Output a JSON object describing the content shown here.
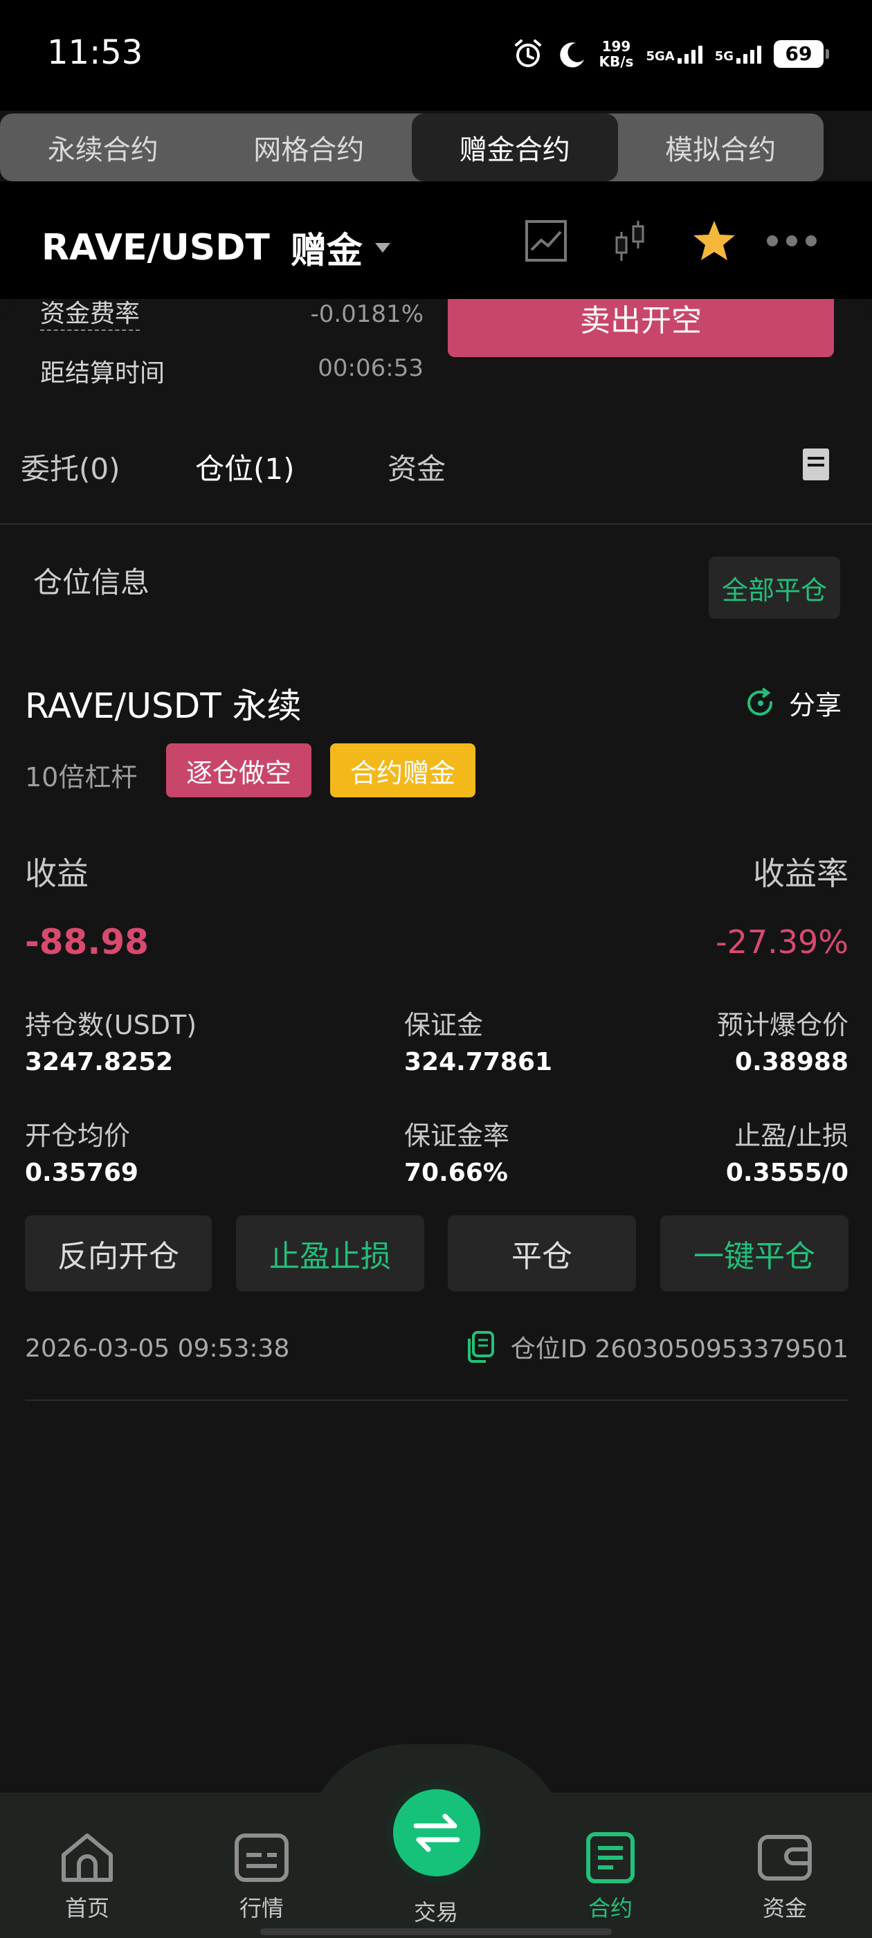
{
  "status_bar": {
    "time": "11:53",
    "speed_value": "199",
    "speed_unit": "KB/s",
    "net1": "5GA",
    "net2": "5G",
    "battery": "69"
  },
  "top_tabs": [
    "永续合约",
    "网格合约",
    "赠金合约",
    "模拟合约"
  ],
  "active_top_tab": 2,
  "header": {
    "pair": "RAVE/USDT",
    "mode": "赠金"
  },
  "funding": {
    "rate_label": "资金费率",
    "rate_value": "-0.0181%",
    "settle_label": "距结算时间",
    "settle_value": "00:06:53",
    "sell_button": "卖出开空"
  },
  "position_tabs": {
    "orders": "委托(0)",
    "positions": "仓位(1)",
    "assets": "资金"
  },
  "position_info": {
    "title": "仓位信息",
    "close_all": "全部平仓"
  },
  "position": {
    "symbol": "RAVE/USDT 永续",
    "share": "分享",
    "leverage": "10倍杠杆",
    "side_tag": "逐仓做空",
    "bonus_tag": "合约赠金",
    "pnl_label": "收益",
    "roi_label": "收益率",
    "pnl_value": "-88.98",
    "roi_value": "-27.39%",
    "size_label": "持仓数(USDT)",
    "size_value": "3247.8252",
    "margin_label": "保证金",
    "margin_value": "324.77861",
    "liq_label": "预计爆仓价",
    "liq_value": "0.38988",
    "entry_label": "开仓均价",
    "entry_value": "0.35769",
    "margin_ratio_label": "保证金率",
    "margin_ratio_value": "70.66%",
    "tpsl_label": "止盈/止损",
    "tpsl_value": "0.3555/0",
    "btn_reverse": "反向开仓",
    "btn_tpsl": "止盈止损",
    "btn_close": "平仓",
    "btn_quick_close": "一键平仓",
    "timestamp": "2026-03-05 09:53:38",
    "id_label": "仓位ID 2603050953379501"
  },
  "bottom_nav": {
    "home": "首页",
    "market": "行情",
    "trade": "交易",
    "contract": "合约",
    "assets": "资金"
  },
  "colors": {
    "accent_green": "#22c07a",
    "loss_red": "#d94a6e",
    "bonus_yellow": "#f3b81a",
    "star_gold": "#f5b83d"
  }
}
